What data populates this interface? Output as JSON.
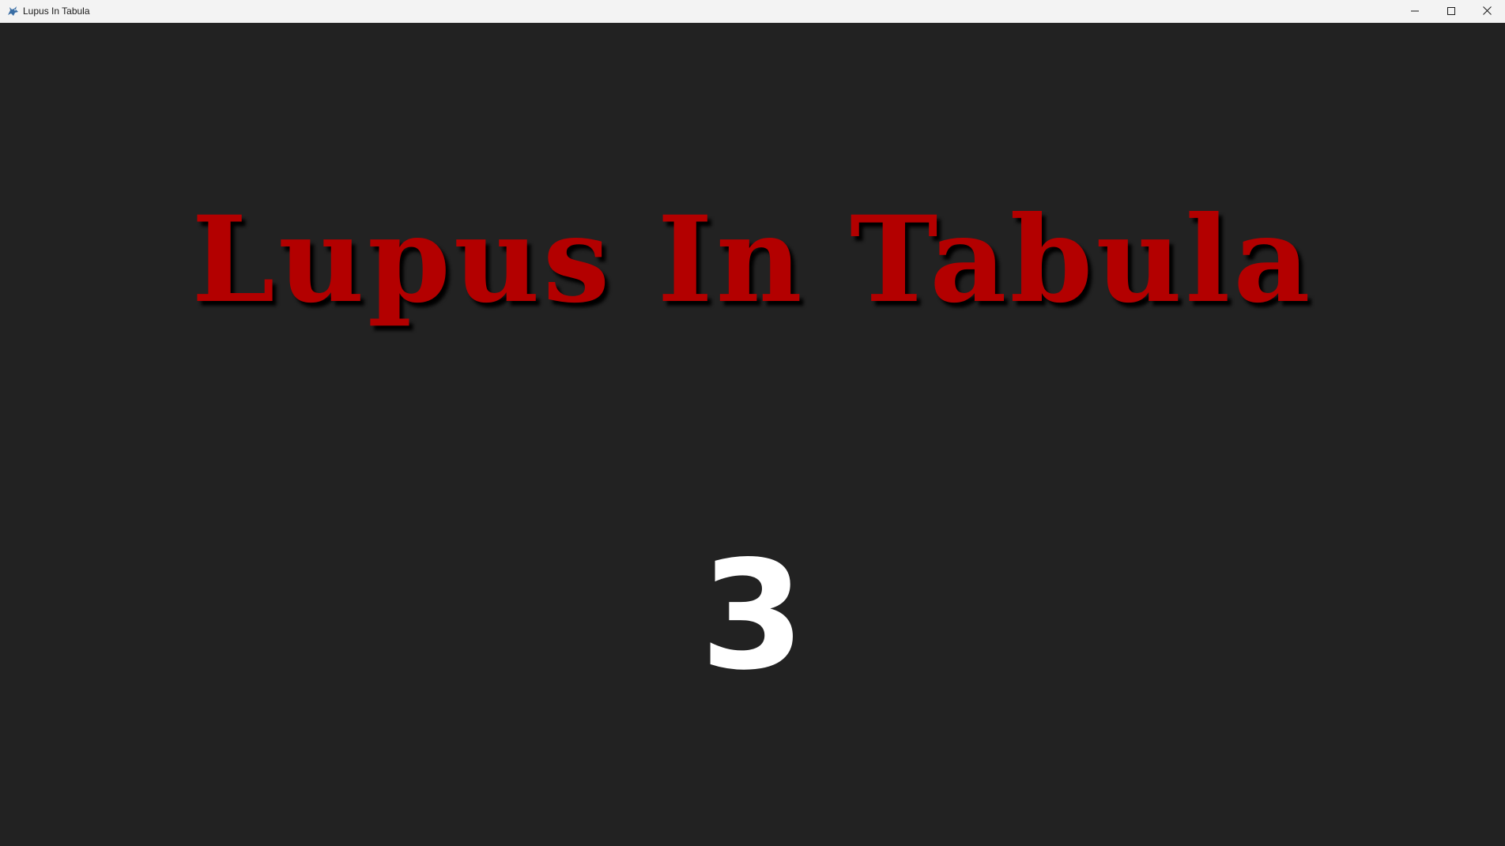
{
  "window": {
    "title": "Lupus In Tabula",
    "app_icon": "wolf-icon",
    "controls": [
      "minimize-icon",
      "maximize-icon",
      "close-icon"
    ]
  },
  "game": {
    "title": "Lupus In Tabula",
    "countdown": "3"
  },
  "colors": {
    "background": "#222222",
    "title_red": "#b30000",
    "countdown_white": "#ffffff",
    "titlebar": "#f3f3f3"
  }
}
